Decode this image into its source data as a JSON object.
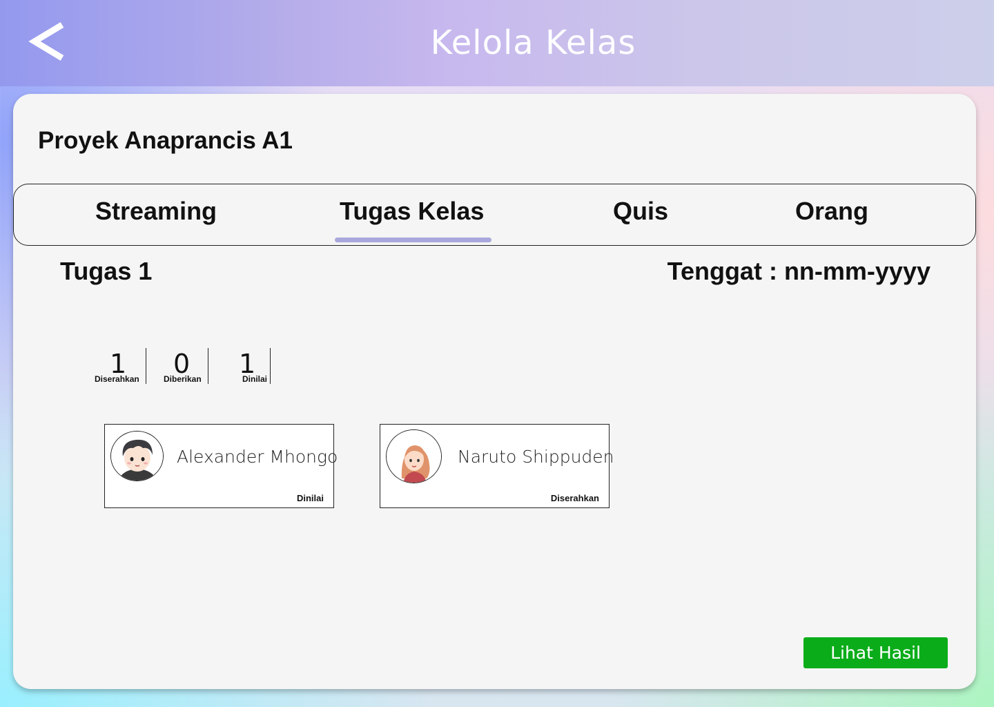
{
  "header": {
    "title": "Kelola Kelas",
    "back_icon": "chevron-left-icon"
  },
  "class": {
    "title": "Proyek Anaprancis A1"
  },
  "tabs": [
    {
      "label": "Streaming",
      "active": false
    },
    {
      "label": "Tugas Kelas",
      "active": true
    },
    {
      "label": "Quis",
      "active": false
    },
    {
      "label": "Orang",
      "active": false
    }
  ],
  "task": {
    "name": "Tugas 1",
    "deadline": "Tenggat : nn-mm-yyyy"
  },
  "stats": [
    {
      "value": "1",
      "label": "Diserahkan"
    },
    {
      "value": "0",
      "label": "Diberikan"
    },
    {
      "value": "1",
      "label": "Dinilai"
    }
  ],
  "students": [
    {
      "name": "Alexander Mhongo",
      "status": "Dinilai",
      "avatar": "boy-avatar-icon"
    },
    {
      "name": "Naruto Shippuden",
      "status": "Diserahkan",
      "avatar": "girl-avatar-icon"
    }
  ],
  "actions": {
    "result_label": "Lihat Hasil"
  },
  "colors": {
    "accent_underline": "#a9a8dc",
    "button_green": "#0aac19"
  }
}
